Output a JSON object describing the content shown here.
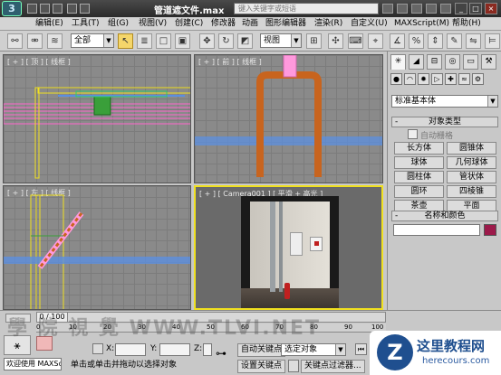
{
  "window": {
    "title": "管道遮文件.max",
    "search_placeholder": "键入关键字或短语",
    "logo": "3"
  },
  "menu": [
    "编辑(E)",
    "工具(T)",
    "组(G)",
    "视图(V)",
    "创建(C)",
    "修改器",
    "动画",
    "图形编辑器",
    "渲染(R)",
    "自定义(U)",
    "MAXScript(M)",
    "帮助(H)"
  ],
  "toolbar": {
    "filter_value": "全部",
    "refcoord_value": "视图"
  },
  "viewports": {
    "top": "[ + ] [ 顶 ] [ 线框 ]",
    "front": "[ + ] [ 前 ] [ 线框 ]",
    "left": "[ + ] [ 左 ] [ 线框 ]",
    "camera": "[ + ] [ Camera001 ] [ 平滑 + 高光 ]"
  },
  "command_panel": {
    "category_value": "标准基本体",
    "object_type_title": "对象类型",
    "autogrid_label": "自动栅格",
    "objects": [
      "长方体",
      "圆锥体",
      "球体",
      "几何球体",
      "圆柱体",
      "管状体",
      "圆环",
      "四棱锥",
      "茶壶",
      "平面"
    ],
    "name_color_title": "名称和颜色",
    "color_swatch": "#9c1a4a"
  },
  "timeline": {
    "frame_display": "0 / 100",
    "ticks": [
      "0",
      "10",
      "20",
      "30",
      "40",
      "50",
      "60",
      "70",
      "80",
      "90",
      "100"
    ]
  },
  "status": {
    "welcome": "欢迎使用 MAXSc",
    "prompt": "单击或单击并拖动以选择对象",
    "x_label": "X:",
    "y_label": "Y:",
    "z_label": "Z:",
    "auto_key": "自动关键点",
    "set_key": "设置关键点",
    "selection_value": "选定对象",
    "key_filters": "关键点过滤器..."
  },
  "brand": {
    "name": "这里教程网",
    "url": "herecours.com"
  },
  "watermark": "學 院 視 覺  WWW.TLVI.NET",
  "colors": {
    "pipe_wire": "#ff66cc",
    "selection_yellow": "#f0e020",
    "wire_blue": "#5b8fe0",
    "pipe_orange": "#c8641e"
  }
}
